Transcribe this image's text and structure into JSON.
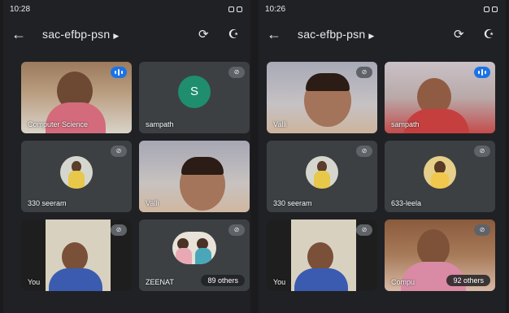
{
  "left": {
    "status": {
      "time": "10:28"
    },
    "appbar": {
      "title": "sac-efbp-psn"
    },
    "tiles": [
      {
        "label": "Computer Science",
        "mic": "speaking"
      },
      {
        "label": "sampath",
        "avatar_letter": "S",
        "mic": "muted"
      },
      {
        "label": "330 seeram",
        "mic": "muted"
      },
      {
        "label": "Valli",
        "mic": "none"
      },
      {
        "label": "You",
        "mic": "muted"
      },
      {
        "label": "ZEENAT",
        "others": "89 others",
        "mic": "muted"
      }
    ]
  },
  "right": {
    "status": {
      "time": "10:26"
    },
    "appbar": {
      "title": "sac-efbp-psn"
    },
    "tiles": [
      {
        "label": "Valli",
        "mic": "muted"
      },
      {
        "label": "sampath",
        "mic": "speaking"
      },
      {
        "label": "330 seeram",
        "mic": "muted"
      },
      {
        "label": "633-leela",
        "mic": "muted"
      },
      {
        "label": "You",
        "mic": "muted"
      },
      {
        "label": "Compu",
        "others": "92 others",
        "mic": "muted"
      }
    ]
  },
  "icons": {
    "back": "arrow-left",
    "caret": "caret-right",
    "switch_camera": "camera-switch",
    "audio": "headphones",
    "mic_off": "mic-off",
    "speaking": "audio-bars"
  },
  "colors": {
    "background": "#202124",
    "tile": "#3c4043",
    "accent": "#1a73e8",
    "avatar_green": "#1e8e6e"
  }
}
